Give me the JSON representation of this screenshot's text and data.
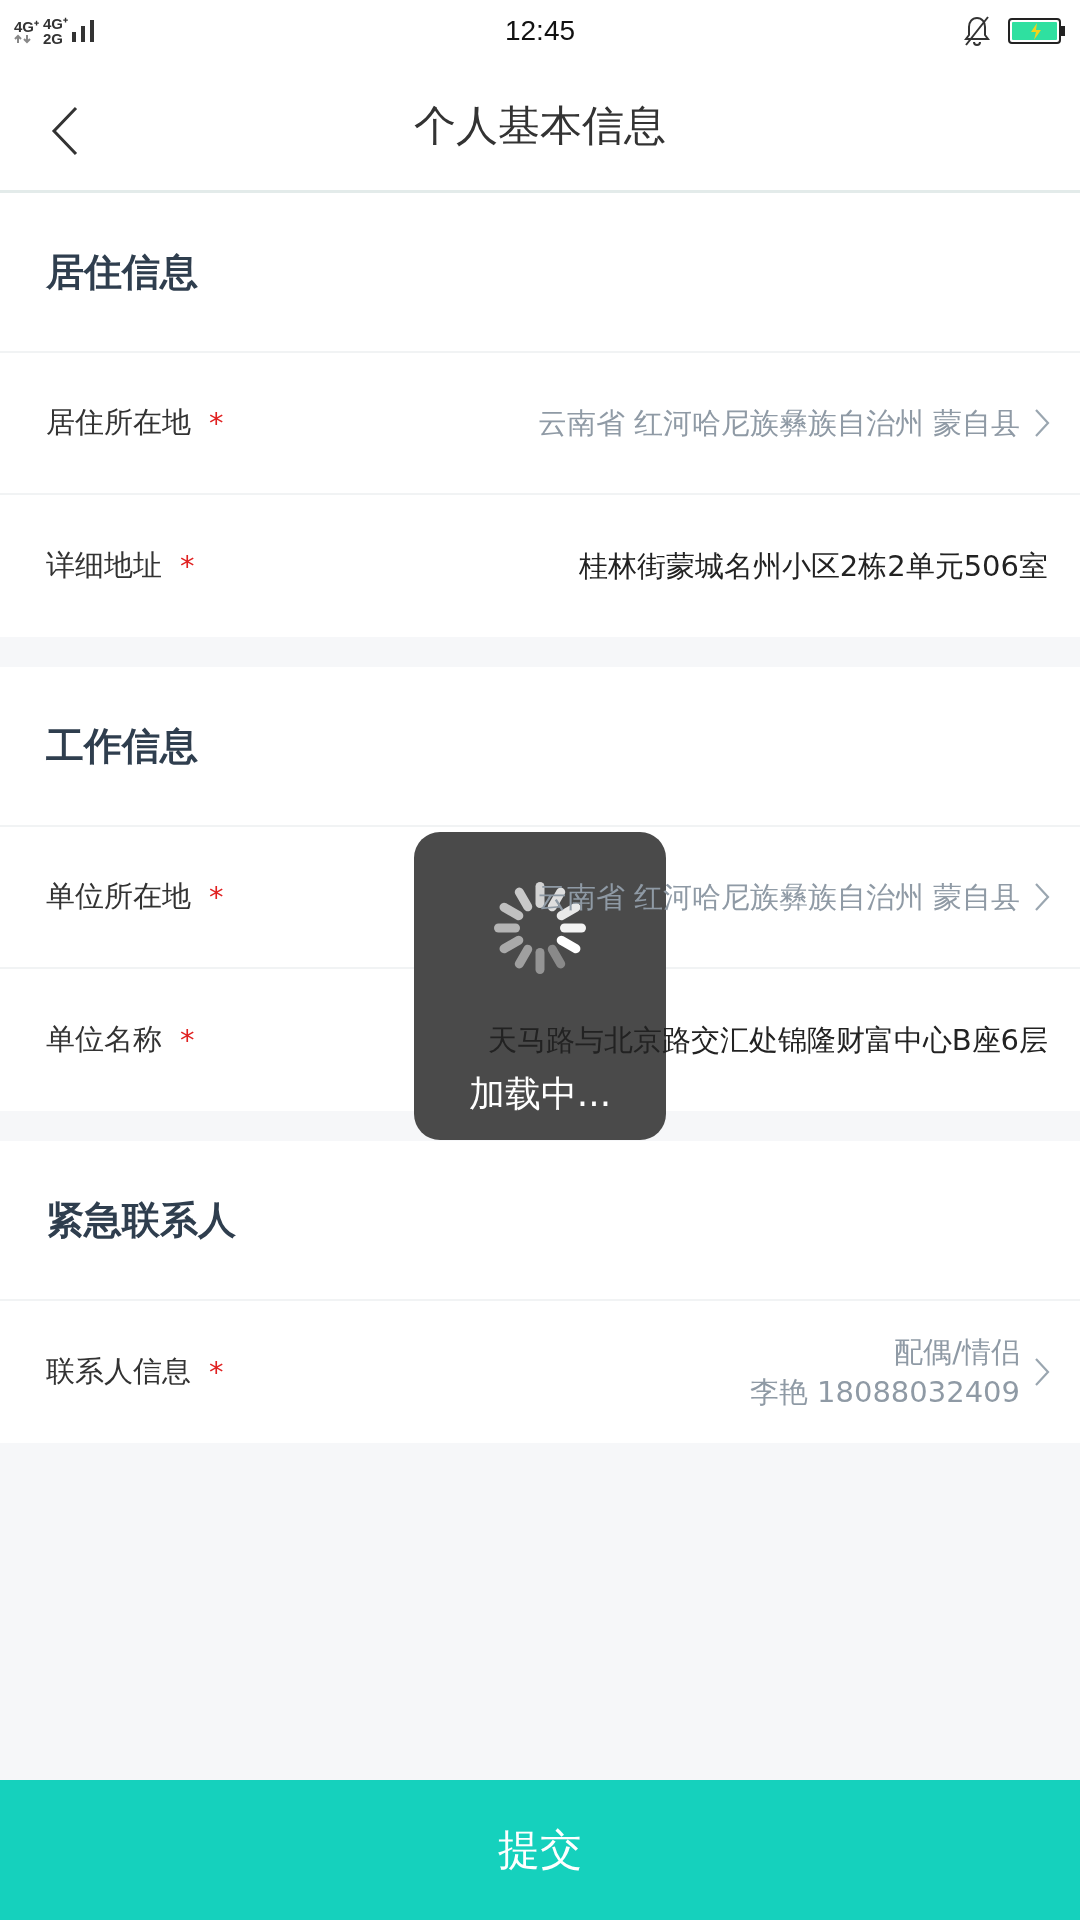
{
  "status_bar": {
    "network_1": "4G⁺",
    "network_2": "4G⁺",
    "network_3": "2G",
    "time": "12:45"
  },
  "header": {
    "title": "个人基本信息"
  },
  "sections": [
    {
      "title": "居住信息",
      "rows": [
        {
          "label": "居住所在地",
          "required_mark": "*",
          "kind": "picker",
          "values": [
            "云南省 红河哈尼族彝族自治州 蒙自县"
          ]
        },
        {
          "label": "详细地址",
          "required_mark": "*",
          "kind": "text",
          "values": [
            "桂林街蒙城名州小区2栋2单元506室"
          ]
        }
      ]
    },
    {
      "title": "工作信息",
      "rows": [
        {
          "label": "单位所在地",
          "required_mark": "*",
          "kind": "picker",
          "values": [
            "云南省 红河哈尼族彝族自治州 蒙自县"
          ]
        },
        {
          "label": "单位名称",
          "required_mark": "*",
          "kind": "text",
          "values": [
            "天马路与北京路交汇处锦隆财富中心B座6层"
          ]
        }
      ]
    },
    {
      "title": "紧急联系人",
      "rows": [
        {
          "label": "联系人信息",
          "required_mark": "*",
          "kind": "picker",
          "values": [
            "配偶/情侣",
            "李艳 18088032409"
          ]
        }
      ]
    }
  ],
  "toast": {
    "text": "加载中..."
  },
  "submit": {
    "label": "提交"
  }
}
